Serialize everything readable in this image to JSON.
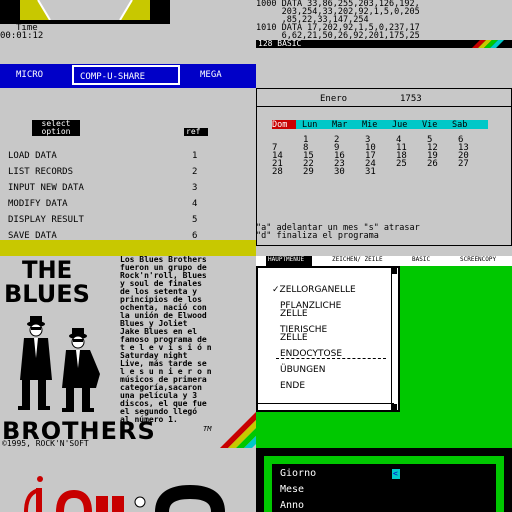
{
  "top_left": {
    "time_label": "Time",
    "time_value": "00:01:12",
    "tabs": [
      "MICRO",
      "COMP-U-SHARE",
      "MEGA"
    ],
    "header_left": "select option",
    "header_right": "ref",
    "menu": [
      {
        "label": "LOAD DATA",
        "ref": "1"
      },
      {
        "label": "LIST RECORDS",
        "ref": "2"
      },
      {
        "label": "INPUT NEW DATA",
        "ref": "3"
      },
      {
        "label": "MODIFY DATA",
        "ref": "4"
      },
      {
        "label": "DISPLAY RESULT",
        "ref": "5"
      },
      {
        "label": "SAVE DATA",
        "ref": "6"
      }
    ]
  },
  "basic": {
    "lines": [
      "1000 DATA 33,86,255,203,126,192,",
      "     203,254,33,202,92,1,5,0,205",
      "     ,85,22,33,147,254",
      "1010 DATA 17,202,92,1,5,0,237,17",
      "     6,62,21,50,26,92,201,175,25"
    ],
    "footer": "128 BASIC"
  },
  "calendar": {
    "month": "Enero",
    "year": "1753",
    "days": [
      "Dom",
      "Lun",
      "Mar",
      "Mie",
      "Jue",
      "Vie",
      "Sab"
    ],
    "weeks": [
      [
        "",
        "1",
        "2",
        "3",
        "4",
        "5",
        "6"
      ],
      [
        "7",
        "8",
        "9",
        "10",
        "11",
        "12",
        "13"
      ],
      [
        "14",
        "15",
        "16",
        "17",
        "18",
        "19",
        "20"
      ],
      [
        "21",
        "22",
        "23",
        "24",
        "25",
        "26",
        "27"
      ],
      [
        "28",
        "29",
        "30",
        "31",
        "",
        "",
        ""
      ]
    ],
    "help1": "\"a\" adelantar un mes \"s\" atrasar",
    "help2": "\"d\" finaliza el programa"
  },
  "blues": {
    "title1": "THE",
    "title2": "BLUES",
    "title3": "BROTHERS",
    "tm": "TM",
    "copyright": "©1995, ROCK'N'SOFT",
    "body": [
      "Los Blues Brothers",
      "fueron un grupo de",
      "Rock'n'roll, Blues",
      "y soul de finales",
      "de los setenta y",
      "principios de los",
      "ochenta, nació con",
      "la unión de Elwood",
      "Blues y Joliet",
      "Jake Blues en el",
      "famoso programa de",
      "t e l e v i s i ó n",
      "Saturday night",
      "Live, más tarde se",
      "l e s u n i e r o n",
      "músicos de primera",
      "categoría,sacaron",
      "una película y 3",
      "discos, el que fue",
      "el segundo llegó",
      "al número 1."
    ]
  },
  "menu_window": {
    "menubar": [
      "HAUPTMENUE",
      "ZEICHEN/ ZEILE",
      "BASIC",
      "SCREENCOPY"
    ],
    "items": [
      "✓ZELLORGANELLE",
      "PFLANZLICHE",
      "ZELLE",
      "TIERISCHE",
      "ZELLE",
      "ENDOCYTOSE",
      "ÜBUNGEN",
      "ENDE"
    ]
  },
  "bottom_right": {
    "fields": [
      "Giorno",
      "Mese",
      "Anno"
    ],
    "marker": "<"
  },
  "colors": {
    "bg_gray": "#c8c8c8",
    "zx_blue": "#0000c8",
    "zx_red": "#c80000",
    "zx_green": "#00c800",
    "zx_cyan": "#00c8c8",
    "zx_yellow": "#c8c800",
    "zx_magenta": "#c800c8"
  }
}
